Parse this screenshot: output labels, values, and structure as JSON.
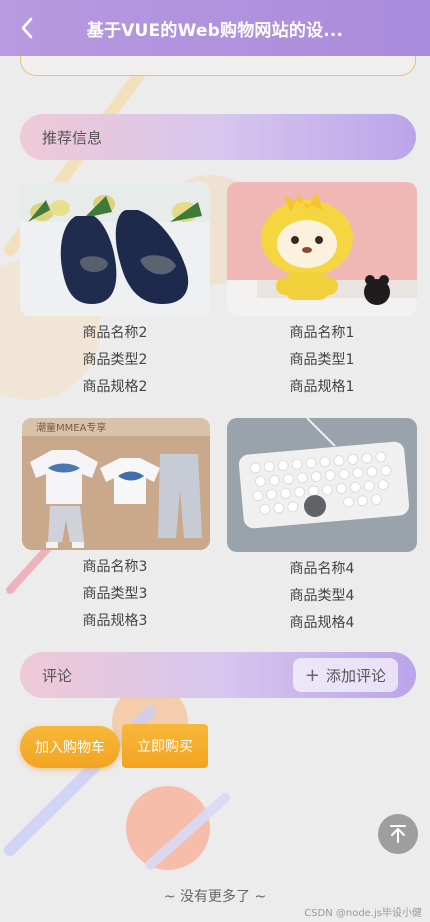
{
  "header": {
    "title": "基于VUE的Web购物网站的设..."
  },
  "recommend": {
    "title": "推荐信息",
    "products": [
      {
        "name": "商品名称2",
        "type": "商品类型2",
        "spec": "商品规格2",
        "image": "navy-flat-shoes"
      },
      {
        "name": "商品名称1",
        "type": "商品类型1",
        "spec": "商品规格1",
        "image": "yellow-plush-toy"
      },
      {
        "name": "商品名称3",
        "type": "商品类型3",
        "spec": "商品规格3",
        "image": "kids-clothing-set",
        "image_text": "潮童MMEA专享"
      },
      {
        "name": "商品名称4",
        "type": "商品类型4",
        "spec": "商品规格4",
        "image": "white-keyboard"
      }
    ]
  },
  "comment": {
    "title": "评论",
    "add_label": "添加评论"
  },
  "actions": {
    "add_to_cart": "加入购物车",
    "buy_now": "立即购买"
  },
  "footer": {
    "no_more": "~ 没有更多了 ~",
    "watermark": "CSDN @node.js毕设小健"
  },
  "colors": {
    "header": "#b89ae0",
    "accent_orange": "#f2a420",
    "bar_start": "#efc9d6",
    "bar_end": "#bba5ea"
  }
}
